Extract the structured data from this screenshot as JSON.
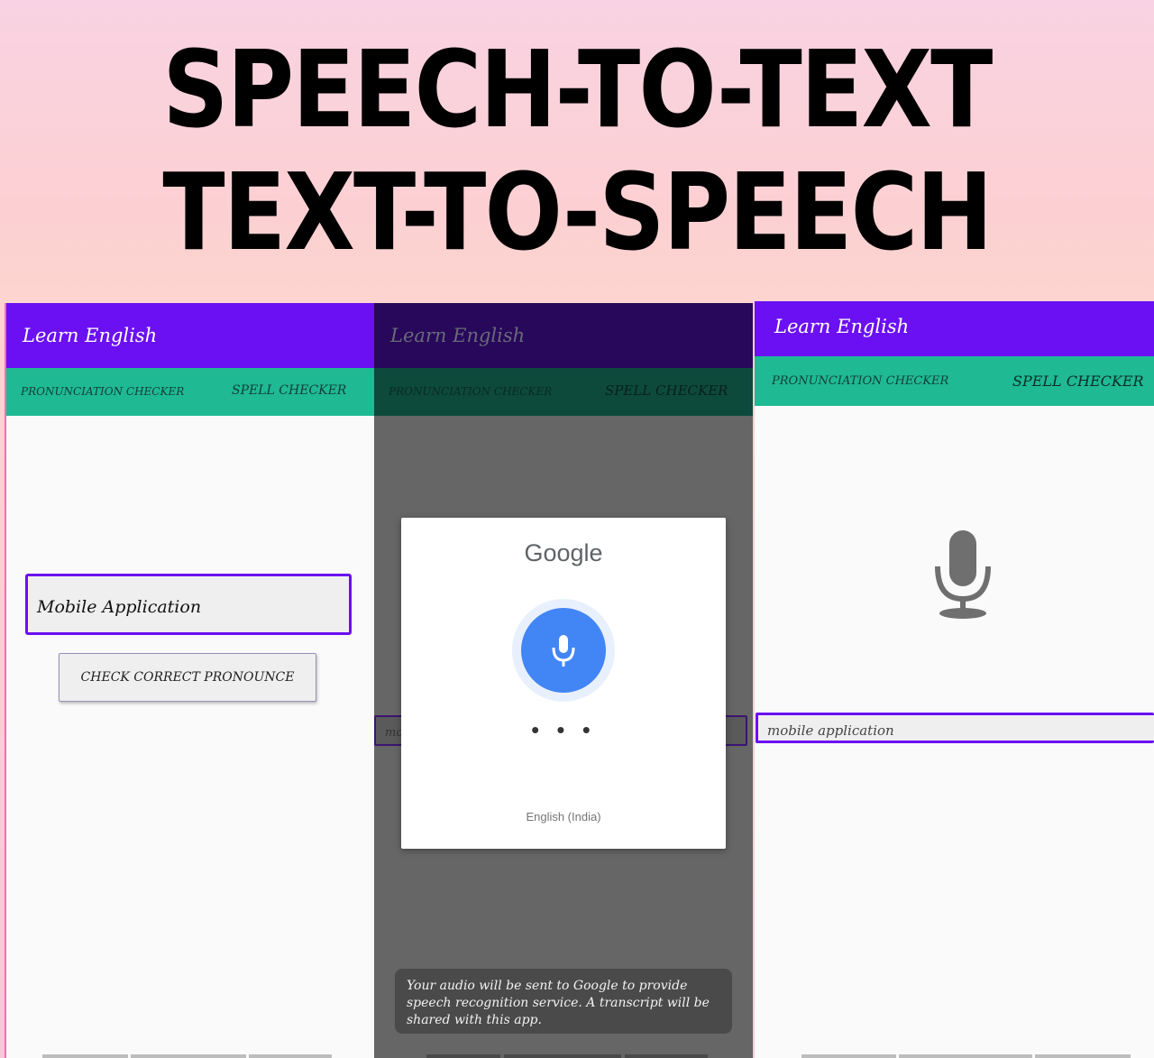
{
  "headline": {
    "line1": "SPEECH-TO-TEXT",
    "line2": "TEXT-TO-SPEECH"
  },
  "screen1": {
    "app_title": "Learn English",
    "tabs": [
      "PRONUNCIATION CHECKER",
      "SPELL CHECKER"
    ],
    "input_value": "Mobile Application",
    "button_label": "CHECK CORRECT PRONOUNCE"
  },
  "screen2": {
    "app_title": "Learn English",
    "tabs": [
      "PRONUNCIATION CHECKER",
      "SPELL CHECKER"
    ],
    "input_value": "mo",
    "dialog": {
      "brand": "Google",
      "mic_icon": "mic-icon",
      "listening_dots": "• • •",
      "language": "English (India)"
    },
    "notice": "Your audio will be sent to Google to provide speech recognition service. A transcript will be shared with this app."
  },
  "screen3": {
    "app_title": "Learn English",
    "tabs": [
      "PRONUNCIATION CHECKER",
      "SPELL CHECKER"
    ],
    "mic_icon": "microphone-icon",
    "input_value": "mobile application"
  },
  "colors": {
    "app_bar": "#6b10f2",
    "tab_bar": "#1fb994",
    "google_blue": "#4285f4"
  }
}
